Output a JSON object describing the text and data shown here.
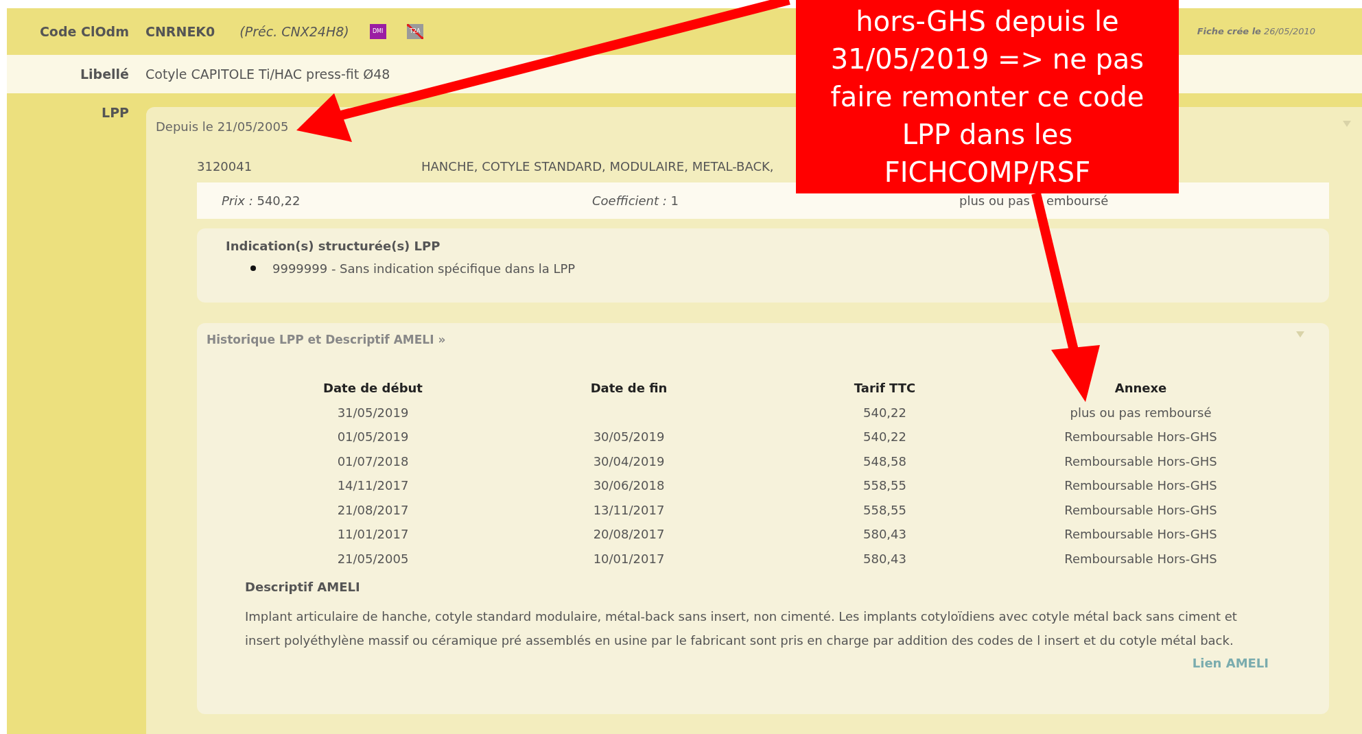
{
  "header": {
    "label": "Code ClOdm",
    "code": "CNRNEK0",
    "previous": "(Préc. CNX24H8)",
    "badges": [
      {
        "text": "DMI",
        "kind": "active"
      },
      {
        "text": "T2A",
        "kind": "crossed"
      }
    ],
    "created": "**Fiche crée le** 26/05/2010"
  },
  "libelle": {
    "label": "Libellé",
    "value": "Cotyle CAPITOLE Ti/HAC press-fit Ø48"
  },
  "lpp": {
    "label": "LPP",
    "since": "Depuis le 21/05/2005",
    "code": "3120041",
    "description": "HANCHE, COTYLE STANDARD, MODULAIRE, METAL-BACK,",
    "price": "*Prix :* 540,22",
    "coefficient": "*Coefficient :* 1",
    "status": [
      "plus ou pas",
      "emboursé"
    ],
    "indications": {
      "title": "Indication(s) structurée(s) LPP",
      "items": [
        "9999999 - Sans indication spécifique dans la LPP"
      ]
    },
    "history": {
      "title": "Historique LPP et Descriptif AMELI »",
      "columns": [
        "Date de début",
        "Date de fin",
        "Tarif TTC",
        "Annexe"
      ],
      "rows": [
        [
          "31/05/2019",
          "",
          "540,22",
          "plus ou pas remboursé"
        ],
        [
          "01/05/2019",
          "30/05/2019",
          "540,22",
          "Remboursable Hors-GHS"
        ],
        [
          "01/07/2018",
          "30/04/2019",
          "548,58",
          "Remboursable Hors-GHS"
        ],
        [
          "14/11/2017",
          "30/06/2018",
          "558,55",
          "Remboursable Hors-GHS"
        ],
        [
          "21/08/2017",
          "13/11/2017",
          "558,55",
          "Remboursable Hors-GHS"
        ],
        [
          "11/01/2017",
          "20/08/2017",
          "580,43",
          "Remboursable Hors-GHS"
        ],
        [
          "21/05/2005",
          "10/01/2017",
          "580,43",
          "Remboursable Hors-GHS"
        ]
      ],
      "description_title": "Descriptif AMELI",
      "description": "Implant articulaire de hanche, cotyle standard modulaire, métal-back sans insert, non cimenté. Les implants cotyloïdiens avec cotyle métal back sans ciment et insert polyéthylène massif ou céramique pré assemblés en usine par le fabricant sont pris en charge par addition des codes de l insert et du cotyle métal back.",
      "link": "Lien AMELI"
    }
  },
  "annotation": {
    "lines": [
      "hors-GHS depuis le",
      "31/05/2019 => ne pas",
      "faire remonter ce code",
      "LPP dans les",
      "FICHCOMP/RSF"
    ]
  }
}
